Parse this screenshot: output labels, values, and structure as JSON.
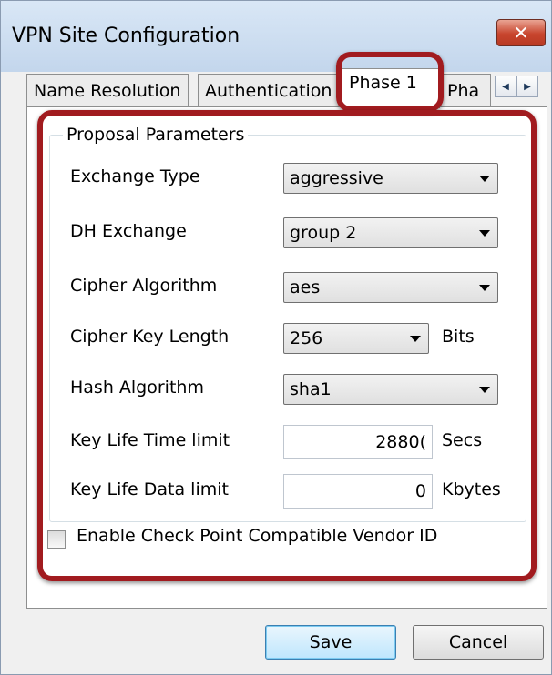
{
  "window": {
    "title": "VPN Site Configuration",
    "close_glyph": "✕"
  },
  "tabs": [
    {
      "label": "Name Resolution"
    },
    {
      "label": "Authentication"
    },
    {
      "label": "Phase 1",
      "active": true
    },
    {
      "label": "Pha"
    }
  ],
  "tab_scroll": {
    "left": "◀",
    "right": "▶"
  },
  "proposal": {
    "legend": "Proposal Parameters",
    "exchange_type": {
      "label": "Exchange Type",
      "value": "aggressive"
    },
    "dh_exchange": {
      "label": "DH Exchange",
      "value": "group 2"
    },
    "cipher_algorithm": {
      "label": "Cipher Algorithm",
      "value": "aes"
    },
    "cipher_key_length": {
      "label": "Cipher Key Length",
      "value": "256",
      "unit": "Bits"
    },
    "hash_algorithm": {
      "label": "Hash Algorithm",
      "value": "sha1"
    },
    "key_life_time": {
      "label": "Key Life Time limit",
      "value": "2880(",
      "unit": "Secs"
    },
    "key_life_data": {
      "label": "Key Life Data limit",
      "value": "0",
      "unit": "Kbytes"
    }
  },
  "vendor_id": {
    "label": "Enable Check Point Compatible Vendor ID",
    "checked": false
  },
  "buttons": {
    "save": "Save",
    "cancel": "Cancel"
  },
  "colors": {
    "highlight": "#a11b1f",
    "titlebar": "#c3d6ec",
    "close": "#c8452e"
  }
}
